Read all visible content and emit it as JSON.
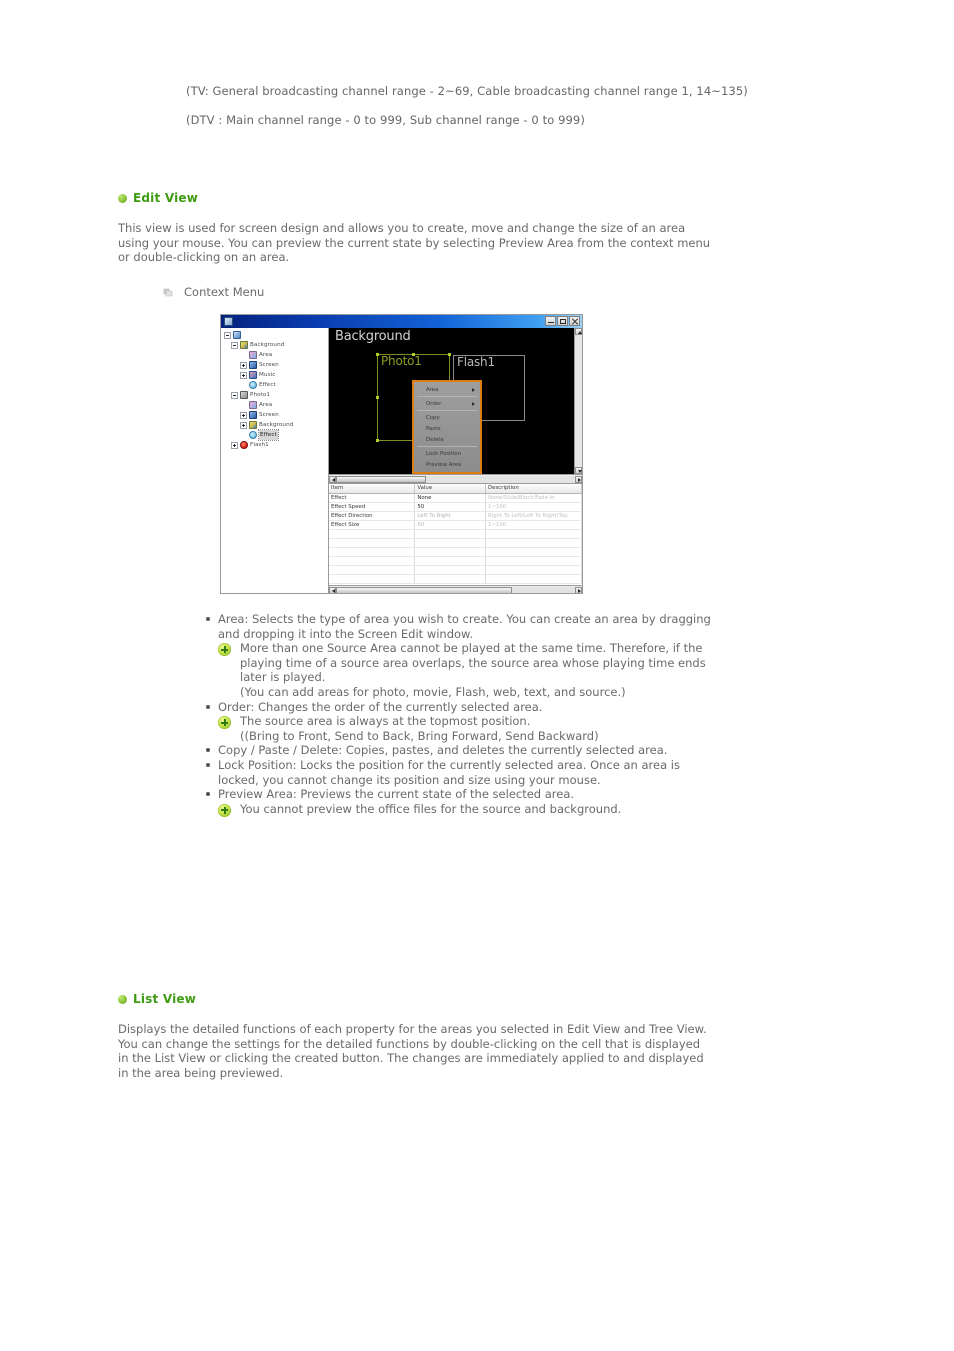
{
  "notes": {
    "tv_range": "(TV: General broadcasting channel range - 2~69, Cable broadcasting channel range 1, 14~135)",
    "dtv_range": "(DTV : Main channel range - 0 to 999, Sub channel range - 0 to 999)"
  },
  "edit_view": {
    "heading": "Edit View",
    "description": "This view is used for screen design and allows you to create, move and change the size of an area using your mouse. You can preview the current state by selecting Preview Area from the context menu or double-clicking on an area.",
    "caption": "Context Menu",
    "bullets": [
      {
        "text": "Area: Selects the type of area you wish to create. You can create an area by dragging and dropping it into the Screen Edit window.",
        "notes": [
          "More than one Source Area cannot be played at the same time. Therefore, if the playing time of a source area overlaps, the source area whose playing time ends later is played.",
          "(You can add areas for photo, movie, Flash, web, text, and source.)"
        ]
      },
      {
        "text": "Order: Changes the order of the currently selected area.",
        "notes": [
          "The source area is always at the topmost position.",
          "((Bring to Front, Send to Back, Bring Forward, Send Backward)"
        ]
      },
      {
        "text": "Copy / Paste / Delete: Copies, pastes, and deletes the currently selected area.",
        "notes": []
      },
      {
        "text": "Lock Position: Locks the position for the currently selected area. Once an area is locked, you cannot change its position and size using your mouse.",
        "notes": []
      },
      {
        "text": "Preview Area: Previews the current state of the selected area.",
        "notes": [
          "You cannot preview the office files for the source and background."
        ]
      }
    ]
  },
  "list_view": {
    "heading": "List View",
    "description": "Displays the detailed functions of each property for the areas you selected in Edit View and Tree View. You can change the settings for the detailed functions by double-clicking on the cell that is displayed in the List View or clicking the created button. The changes are immediately applied to and displayed in the area being previewed."
  },
  "app_screenshot": {
    "window_title": "",
    "window_buttons": [
      "minimize",
      "maximize",
      "close"
    ],
    "tree": [
      {
        "label": "",
        "icon": "root-icon",
        "indent": 0,
        "expander": "minus",
        "selected": false
      },
      {
        "label": "Background",
        "icon": "background-icon",
        "indent": 1,
        "expander": "minus",
        "selected": false
      },
      {
        "label": "Area",
        "icon": "area-icon",
        "indent": 2,
        "expander": "none",
        "selected": false
      },
      {
        "label": "Screen",
        "icon": "screen-icon",
        "indent": 2,
        "expander": "plus",
        "selected": false
      },
      {
        "label": "Music",
        "icon": "music-icon",
        "indent": 2,
        "expander": "plus",
        "selected": false
      },
      {
        "label": "Effect",
        "icon": "effect-icon",
        "indent": 2,
        "expander": "none",
        "selected": false
      },
      {
        "label": "Photo1",
        "icon": "photo-icon",
        "indent": 1,
        "expander": "minus",
        "selected": false
      },
      {
        "label": "Area",
        "icon": "area-icon",
        "indent": 2,
        "expander": "none",
        "selected": false
      },
      {
        "label": "Screen",
        "icon": "screen-icon",
        "indent": 2,
        "expander": "plus",
        "selected": false
      },
      {
        "label": "Background",
        "icon": "background-icon",
        "indent": 2,
        "expander": "plus",
        "selected": false
      },
      {
        "label": "Effect",
        "icon": "effect-icon",
        "indent": 2,
        "expander": "none",
        "selected": true
      },
      {
        "label": "Flash1",
        "icon": "flash-icon",
        "indent": 1,
        "expander": "plus",
        "selected": false
      }
    ],
    "canvas": {
      "title": "Background",
      "areas": [
        {
          "label": "Photo1",
          "selected": true
        },
        {
          "label": "Flash1",
          "selected": false
        }
      ]
    },
    "context_menu": {
      "items": [
        {
          "label": "Area",
          "submenu": true
        },
        {
          "label": "Order",
          "submenu": true
        },
        {
          "label": "Copy",
          "submenu": false
        },
        {
          "label": "Paste",
          "submenu": false
        },
        {
          "label": "Delete",
          "submenu": false
        },
        {
          "label": "Lock Position",
          "submenu": false
        },
        {
          "label": "Preview Area",
          "submenu": false
        }
      ]
    },
    "property_grid": {
      "headers": [
        "Item",
        "Value",
        "Description"
      ],
      "rows": [
        {
          "item": "Effect",
          "value": "None",
          "description": "None/Slide/Block/Fade In"
        },
        {
          "item": "Effect Speed",
          "value": "50",
          "description": "1~100"
        },
        {
          "item": "Effect Direction",
          "value": "Left To Right",
          "description": "Right To Left/Left To Right/Top"
        },
        {
          "item": "Effect Size",
          "value": "50",
          "description": "1~100"
        }
      ]
    }
  },
  "colors": {
    "heading_green": "#3f9c12",
    "body_gray": "#6a6a6a",
    "selected_area": "#8e9c22",
    "context_menu_border": "#e07b12",
    "titlebar_start": "#04227e",
    "titlebar_end": "#9dd2f8"
  }
}
